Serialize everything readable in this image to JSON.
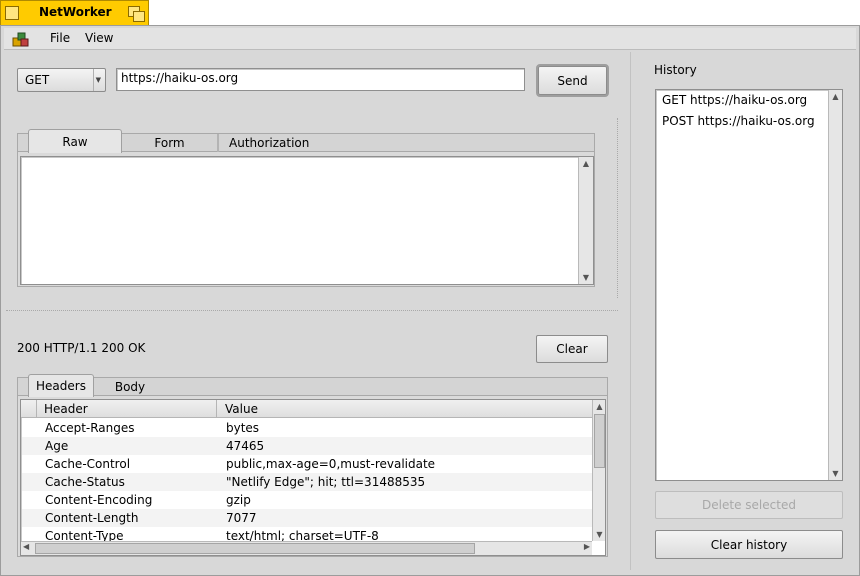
{
  "window": {
    "title": "NetWorker"
  },
  "menu": {
    "app_icon": "app-icon",
    "file": "File",
    "view": "View"
  },
  "request": {
    "method": "GET",
    "url": "https://haiku-os.org",
    "send_label": "Send",
    "tabs": [
      "Raw",
      "Form",
      "Authorization"
    ],
    "active_tab": "Raw",
    "body_text": ""
  },
  "response": {
    "status": "200 HTTP/1.1 200 OK",
    "clear_label": "Clear",
    "tabs": [
      "Headers",
      "Body"
    ],
    "active_tab": "Headers",
    "columns": [
      "Header",
      "Value"
    ],
    "rows": [
      {
        "header": "Accept-Ranges",
        "value": "bytes"
      },
      {
        "header": "Age",
        "value": "47465"
      },
      {
        "header": "Cache-Control",
        "value": "public,max-age=0,must-revalidate"
      },
      {
        "header": "Cache-Status",
        "value": "\"Netlify Edge\"; hit; ttl=31488535"
      },
      {
        "header": "Content-Encoding",
        "value": "gzip"
      },
      {
        "header": "Content-Length",
        "value": "7077"
      },
      {
        "header": "Content-Type",
        "value": "text/html; charset=UTF-8"
      }
    ]
  },
  "history": {
    "title": "History",
    "items": [
      "GET https://haiku-os.org",
      "POST https://haiku-os.org"
    ],
    "delete_label": "Delete selected",
    "clear_label": "Clear history"
  },
  "colors": {
    "tab_yellow": "#ffcb00",
    "panel_gray": "#d8d8d8"
  }
}
